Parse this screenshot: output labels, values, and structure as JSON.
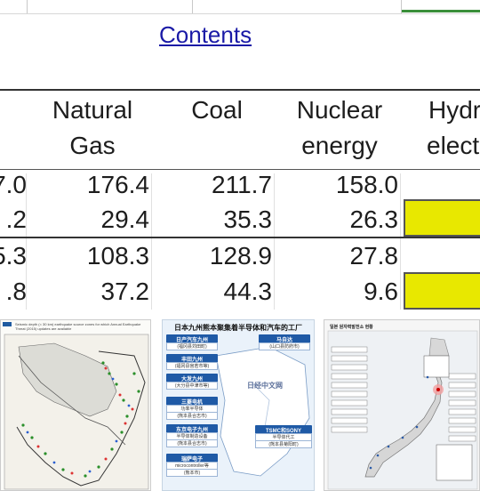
{
  "link": {
    "contents": "Contents"
  },
  "table": {
    "headers": [
      {
        "line1": "Natural",
        "line2": "Gas"
      },
      {
        "line1": "Coal",
        "line2": ""
      },
      {
        "line1": "Nuclear",
        "line2": "energy"
      },
      {
        "line1": "Hydr",
        "line2": "electr"
      }
    ],
    "rows": [
      {
        "first": "7.0",
        "gas": "176.4",
        "coal": "211.7",
        "nuclear": "158.0"
      },
      {
        "first": ".2",
        "gas": "29.4",
        "coal": "35.3",
        "nuclear": "26.3"
      },
      {
        "first": "5.3",
        "gas": "108.3",
        "coal": "128.9",
        "nuclear": "27.8"
      },
      {
        "first": ".8",
        "gas": "37.2",
        "coal": "44.3",
        "nuclear": "9.6"
      }
    ],
    "highlight_color": "#e8e800"
  },
  "thumbnails": {
    "map_caption": "Seismic depth (< 30 km) earthquake source zones for which Annual Earthquake Threat (2015) updates are available",
    "factory": {
      "title": "日本九州熊本聚集着半导体和汽车的工厂",
      "boxes": [
        {
          "name": "日产汽车九州",
          "sub": "(福冈县苅田町)"
        },
        {
          "name": "丰田九州",
          "sub": "(福冈县宫若市等)"
        },
        {
          "name": "大发九州",
          "sub": "(大分县中津市等)"
        },
        {
          "name": "三菱电机",
          "sub": "功率半导体"
        },
        {
          "name": "东京电子九州",
          "sub": "半导体制造设备"
        },
        {
          "name": "瑞萨电子",
          "sub": "microcontroller等"
        },
        {
          "name": "马自达",
          "sub": "(山口县防府市)"
        },
        {
          "name": "TSMC和SONY",
          "sub": "半导体代工"
        }
      ],
      "watermark": "日经中文网",
      "detail_1": "(熊本县合志市)",
      "detail_2": "(熊本县合志市)",
      "detail_3": "(熊本市)",
      "detail_4": "(熊本县菊阳町)"
    },
    "japan_map": {
      "title": "일본 원자력발전소 현황"
    }
  }
}
